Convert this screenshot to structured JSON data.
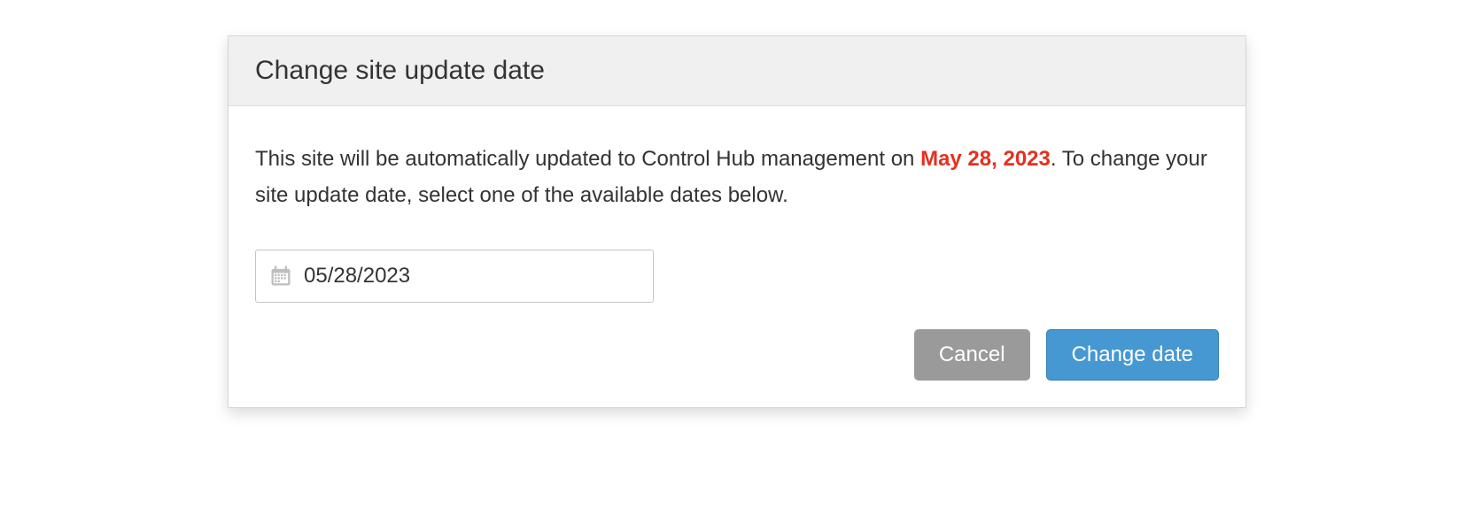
{
  "dialog": {
    "title": "Change site update date",
    "description_pre": "This site will be automatically updated to Control Hub management on ",
    "description_date": "May 28, 2023",
    "description_post": ". To change your site update date, select one of the available dates below.",
    "date_value": "05/28/2023",
    "cancel_label": "Cancel",
    "submit_label": "Change date"
  }
}
